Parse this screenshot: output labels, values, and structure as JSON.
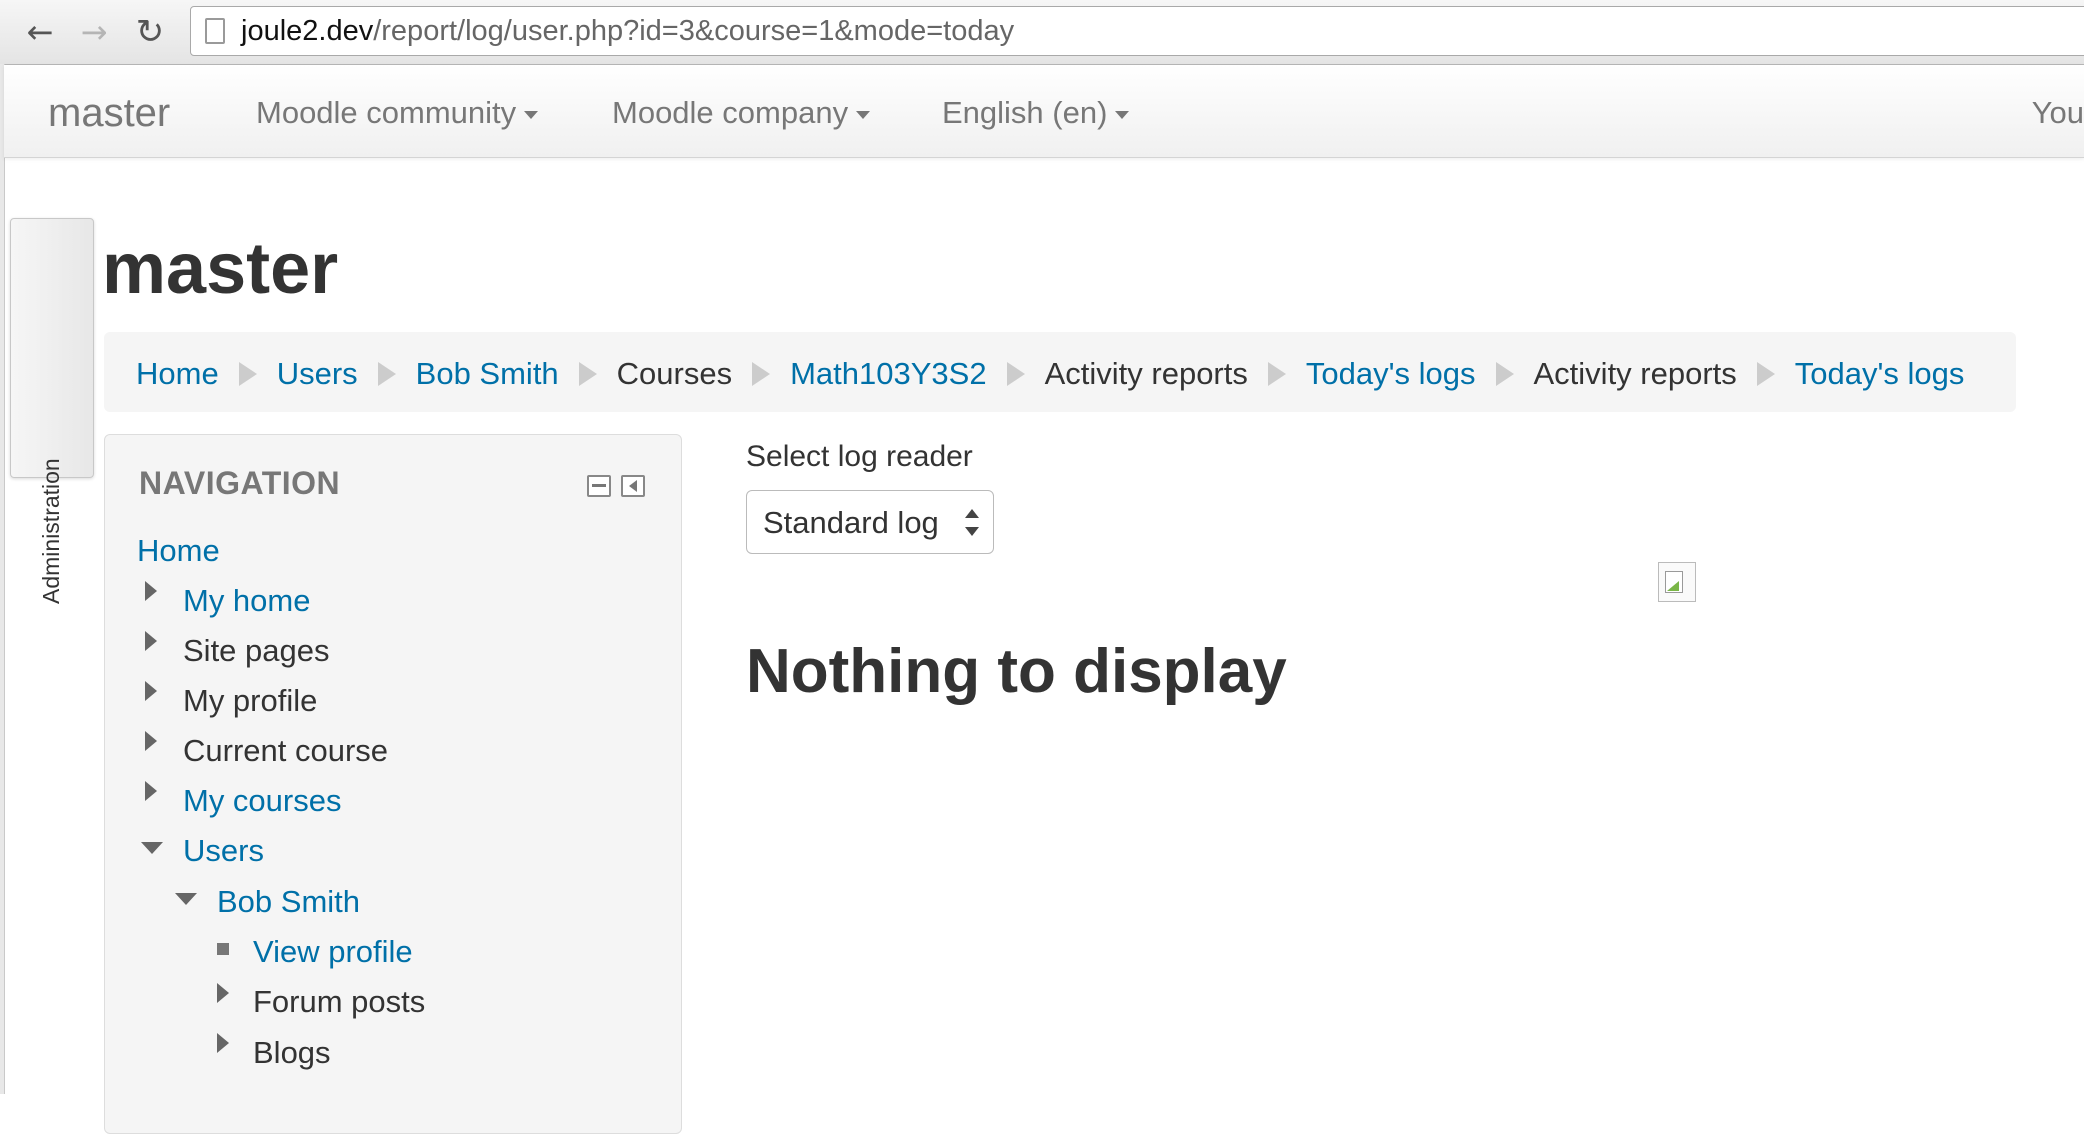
{
  "browser": {
    "url_host": "joule2.dev",
    "url_path": "/report/log/user.php?id=3&course=1&mode=today"
  },
  "navbar": {
    "brand": "master",
    "menus": [
      {
        "label": "Moodle community"
      },
      {
        "label": "Moodle company"
      },
      {
        "label": "English (en)"
      }
    ],
    "user_text": "You"
  },
  "admin_tab": {
    "label": "Administration"
  },
  "site_title": "master",
  "breadcrumb": [
    {
      "label": "Home"
    },
    {
      "label": "Users"
    },
    {
      "label": "Bob Smith"
    },
    {
      "label": "Courses"
    },
    {
      "label": "Math103Y3S2"
    },
    {
      "label": "Activity reports"
    },
    {
      "label": "Today's logs"
    },
    {
      "label": "Activity reports"
    },
    {
      "label": "Today's logs"
    }
  ],
  "navigation": {
    "title": "NAVIGATION",
    "items": [
      {
        "label": "Home"
      },
      {
        "label": "My home"
      },
      {
        "label": "Site pages"
      },
      {
        "label": "My profile"
      },
      {
        "label": "Current course"
      },
      {
        "label": "My courses"
      },
      {
        "label": "Users"
      },
      {
        "label": "Bob Smith"
      },
      {
        "label": "View profile"
      },
      {
        "label": "Forum posts"
      },
      {
        "label": "Blogs"
      }
    ]
  },
  "log_reader": {
    "label": "Select log reader",
    "selected": "Standard log"
  },
  "empty_message": "Nothing to display",
  "colors": {
    "link": "#0070a8",
    "text": "#333333",
    "muted": "#777777"
  },
  "icons": [
    "back-arrow-icon",
    "forward-arrow-icon",
    "reload-icon",
    "page-icon",
    "caret-down-icon",
    "breadcrumb-separator-icon",
    "expand-icon",
    "collapse-icon",
    "minimize-block-icon",
    "dock-block-icon",
    "broken-image-icon"
  ]
}
